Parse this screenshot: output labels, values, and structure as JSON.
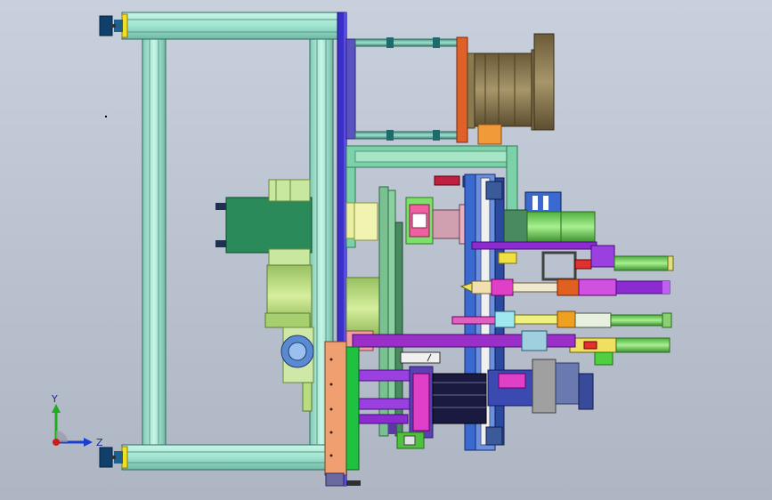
{
  "viewport": {
    "background_top": "#c9d0dd",
    "background_bottom": "#aeb6c4"
  },
  "triad": {
    "y_label": "Y",
    "z_label": "Z",
    "y_color": "#22aa22",
    "z_color": "#1a3fd0",
    "origin_color": "#d01a1a"
  },
  "palette": {
    "frame_profile": "#9fe3d0",
    "frame_edge": "#2f6a5c",
    "base_plate": "#3b2fc9",
    "foot_color": "#1f4c8a",
    "motor_dark": "#7a6a44",
    "motor_mid": "#9a8858",
    "flange_orange": "#e0602a",
    "bracket_green": "#7dd1a8",
    "gearbox_green": "#b8dc7e",
    "cylinder_green": "#7de06a",
    "purple_part": "#8b2bd0",
    "magenta_part": "#e040c8",
    "salmon_plate": "#f0a070"
  }
}
